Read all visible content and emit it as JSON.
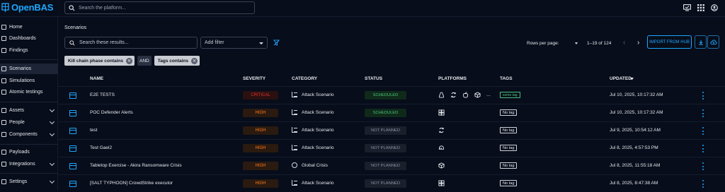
{
  "app": {
    "title": "OpenBAS"
  },
  "search": {
    "placeholder": "Search the platform..."
  },
  "colors": {
    "accent": "#1ea7ff",
    "critical": "#e0322c",
    "high": "#ff7a1a",
    "scheduled": "#4cc27a",
    "not_planned": "#8d93a3"
  },
  "sidebar": {
    "items": [
      {
        "label": "Home",
        "icon": "home-icon"
      },
      {
        "label": "Dashboards",
        "icon": "dashboard-icon"
      },
      {
        "label": "Findings",
        "icon": "findings-icon"
      },
      {
        "label": "Scenarios",
        "icon": "scenarios-icon",
        "active": true
      },
      {
        "label": "Simulations",
        "icon": "simulations-icon"
      },
      {
        "label": "Atomic testings",
        "icon": "atomic-icon"
      },
      {
        "label": "Assets",
        "icon": "assets-icon",
        "expandable": true
      },
      {
        "label": "People",
        "icon": "people-icon",
        "expandable": true
      },
      {
        "label": "Components",
        "icon": "components-icon",
        "expandable": true
      },
      {
        "label": "Payloads",
        "icon": "payloads-icon"
      },
      {
        "label": "Integrations",
        "icon": "integrations-icon",
        "expandable": true
      },
      {
        "label": "Settings",
        "icon": "settings-icon",
        "expandable": true
      }
    ]
  },
  "main": {
    "title": "Scenarios",
    "filter_search_placeholder": "Search these results...",
    "add_filter_label": "Add filter",
    "chips": [
      {
        "label": "Kill chain phase contains"
      },
      {
        "operator": "AND"
      },
      {
        "label": "Tags contains"
      }
    ],
    "rows_per_page_label": "Rows per page:",
    "range_label": "1–19 of 124",
    "import_button": "IMPORT FROM HUB",
    "columns": {
      "name": "NAME",
      "severity": "SEVERITY",
      "category": "CATEGORY",
      "status": "STATUS",
      "platforms": "PLATFORMS",
      "tags": "TAGS",
      "updated": "UPDATED"
    },
    "rows": [
      {
        "name": "E2E TESTS",
        "severity": "CRITICAL",
        "category": "Attack Scenario",
        "status": "SCHEDULED",
        "platforms": [
          "linux-icon",
          "agentless-icon",
          "apple-icon",
          "package-icon"
        ],
        "platforms_more": "...",
        "tag": "some tag",
        "updated": "Jul 10, 2025, 10:17:32 AM"
      },
      {
        "name": "POC Defender Alerts",
        "severity": "HIGH",
        "category": "Attack Scenario",
        "status": "SCHEDULED",
        "platforms": [
          "windows-icon"
        ],
        "tag": "No tag",
        "updated": "Jul 10, 2025, 10:17:32 AM"
      },
      {
        "name": "test",
        "severity": "HIGH",
        "category": "Attack Scenario",
        "status": "NOT PLANNED",
        "platforms": [
          "agentless-icon"
        ],
        "tag": "No tag",
        "updated": "Jul 9, 2025, 10:54:12 AM"
      },
      {
        "name": "Test Gael2",
        "severity": "HIGH",
        "category": "Attack Scenario",
        "status": "NOT PLANNED",
        "platforms": [
          "router-icon"
        ],
        "tag": "No tag",
        "updated": "Jul 8, 2025, 4:57:53 PM"
      },
      {
        "name": "Tabletop Exercise - Akira Ransomware Crisis",
        "severity": "HIGH",
        "category": "Global Crisis",
        "status": "NOT PLANNED",
        "platforms": [
          "package-icon"
        ],
        "tag": "No tag",
        "updated": "Jul 8, 2025, 11:55:18 AM"
      },
      {
        "name": "[SALT TYPHOON] CrowdStrike executor",
        "severity": "HIGH",
        "category": "Attack Scenario",
        "status": "NOT PLANNED",
        "platforms": [
          "windows-icon"
        ],
        "tag": "No tag",
        "updated": "Jul 8, 2025, 8:47:38 AM"
      }
    ]
  }
}
